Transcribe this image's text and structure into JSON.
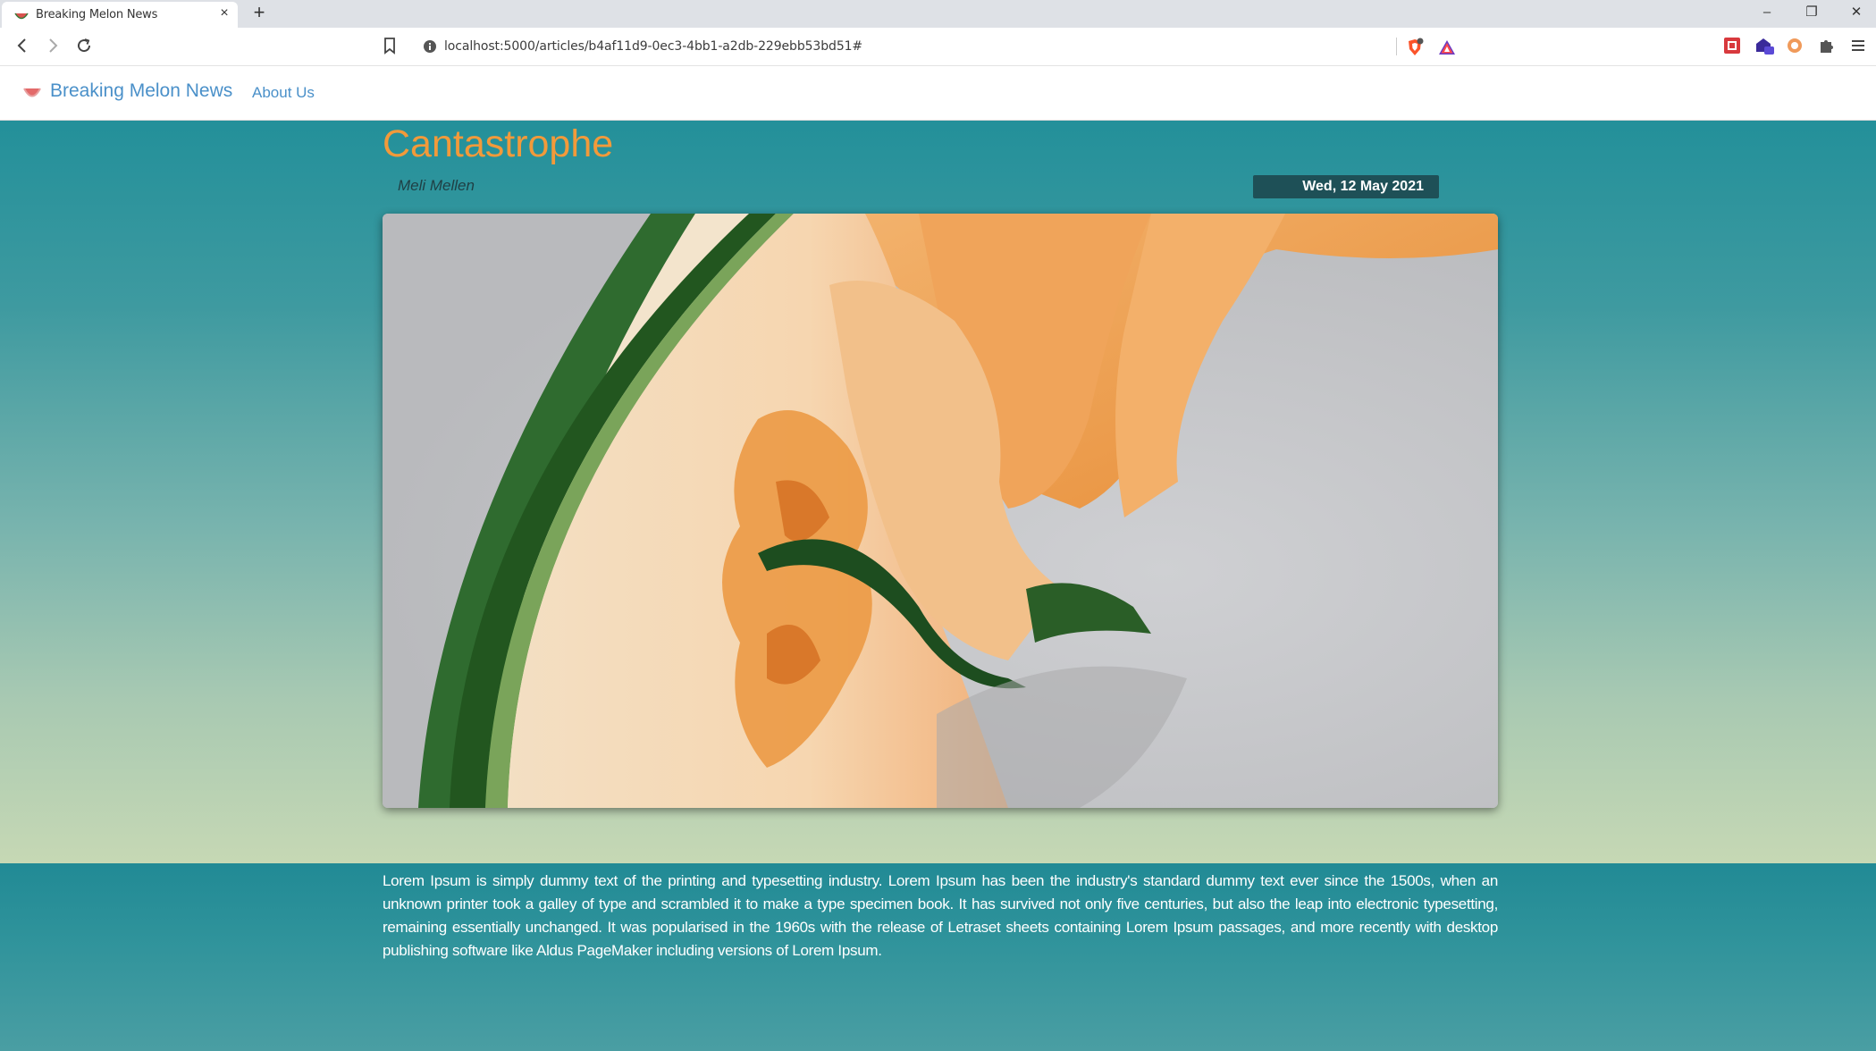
{
  "browser": {
    "tab_title": "Breaking Melon News",
    "tab_close": "×",
    "new_tab": "+",
    "url": "localhost:5000/articles/b4af11d9-0ec3-4bb1-a2db-229ebb53bd51#",
    "window_controls": {
      "minimize": "–",
      "restore": "❐",
      "close": "✕"
    }
  },
  "site": {
    "brand": "Breaking Melon News",
    "nav": {
      "about": "About Us"
    }
  },
  "article": {
    "title": "Cantastrophe",
    "author": "Meli Mellen",
    "date": "Wed, 12 May 2021",
    "body": "Lorem Ipsum is simply dummy text of the printing and typesetting industry. Lorem Ipsum has been the industry's standard dummy text ever since the 1500s, when an unknown printer took a galley of type and scrambled it to make a type specimen book. It has survived not only five centuries, but also the leap into electronic typesetting, remaining essentially unchanged. It was popularised in the 1960s with the release of Letraset sheets containing Lorem Ipsum passages, and more recently with desktop publishing software like Aldus PageMaker including versions of Lorem Ipsum."
  },
  "colors": {
    "brand_link": "#4a90c9",
    "title": "#f29a3a",
    "date_badge_bg": "#1e5057",
    "hero_top": "#23909a",
    "hero_bottom": "#c6d8b4"
  },
  "icons": {
    "tab_favicon": "melon-icon",
    "back": "back-arrow-icon",
    "forward": "forward-arrow-icon",
    "reload": "reload-icon",
    "bookmark": "bookmark-icon",
    "site_info": "info-icon",
    "brave_shield": "brave-shield-icon",
    "brave_rewards": "brave-rewards-icon",
    "extension_1": "extension-red-icon",
    "extension_2": "extension-purple-icon",
    "extension_3": "extension-shield-icon",
    "extensions": "puzzle-icon",
    "menu": "menu-icon",
    "brand": "melon-icon"
  }
}
